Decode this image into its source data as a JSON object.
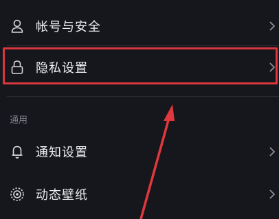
{
  "settings": {
    "account": {
      "label": "帐号与安全",
      "icon": "person-icon"
    },
    "privacy": {
      "label": "隐私设置",
      "icon": "lock-icon"
    },
    "section_general": "通用",
    "notify": {
      "label": "通知设置",
      "icon": "bell-icon"
    },
    "wallpaper": {
      "label": "动态壁纸",
      "icon": "live-wallpaper-icon"
    }
  },
  "colors": {
    "background": "#16171c",
    "highlight": "#d9363e",
    "arrow": "#e0383e",
    "text": "#ededf0",
    "section_text": "#7c7d86"
  }
}
